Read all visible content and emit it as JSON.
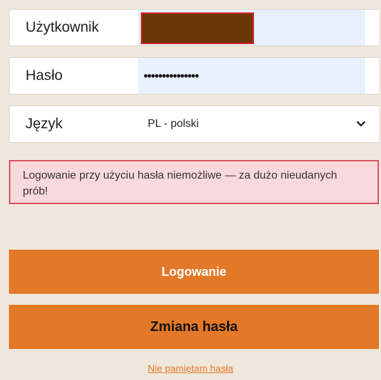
{
  "form": {
    "username_label": "Użytkownik",
    "password_label": "Hasło",
    "password_value": "•••••••••••••••",
    "language_label": "Język",
    "language_value": "PL - polski"
  },
  "error": {
    "message": "Logowanie przy użyciu hasła niemożliwe — za dużo nieudanych prób!"
  },
  "buttons": {
    "login": "Logowanie",
    "change_password": "Zmiana hasła"
  },
  "links": {
    "forgot_password": "Nie pamiętam hasła"
  },
  "colors": {
    "background": "#efe7db",
    "accent": "#e27828",
    "error_bg": "#f8d9dc",
    "error_border": "#d7505a",
    "autofill_bg": "#e8f0fe",
    "redacted_username": "#6b3608"
  },
  "icons": {
    "language_dropdown": "chevron-down-icon"
  }
}
